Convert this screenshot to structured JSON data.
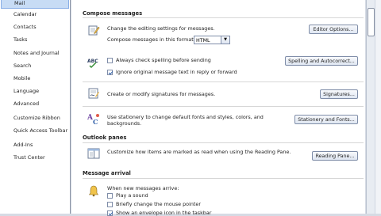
{
  "sidebar": {
    "items": [
      {
        "label": "Mail"
      },
      {
        "label": "Calendar"
      },
      {
        "label": "Contacts"
      },
      {
        "label": "Tasks"
      },
      {
        "label": "Notes and Journal"
      },
      {
        "label": "Search"
      },
      {
        "label": "Mobile"
      },
      {
        "label": "Language"
      },
      {
        "label": "Advanced"
      },
      {
        "label": "Customize Ribbon"
      },
      {
        "label": "Quick Access Toolbar"
      },
      {
        "label": "Add-Ins"
      },
      {
        "label": "Trust Center"
      }
    ]
  },
  "sections": {
    "compose": {
      "title": "Compose messages",
      "edit_settings": "Change the editing settings for messages.",
      "editor_options_button": "Editor Options...",
      "format_label": "Compose messages in this format:",
      "format_value": "HTML",
      "spell_check_label": "Always check spelling before sending",
      "spell_check_button": "Spelling and Autocorrect...",
      "ignore_original_label": "Ignore original message text in reply or forward",
      "signatures_label": "Create or modify signatures for messages.",
      "signatures_button": "Signatures...",
      "stationery_label_1": "Use stationery to change default fonts and styles, colors, and",
      "stationery_label_2": "backgrounds.",
      "stationery_button": "Stationery and Fonts..."
    },
    "outlook_panes": {
      "title": "Outlook panes",
      "reading_pane_label": "Customize how items are marked as read when using the Reading Pane.",
      "reading_pane_button": "Reading Pane..."
    },
    "message_arrival": {
      "title": "Message arrival",
      "when_new_label": "When new messages arrive:",
      "play_sound_label": "Play a sound",
      "change_pointer_label": "Briefly change the mouse pointer",
      "envelope_label": "Show an envelope icon in the taskbar"
    }
  },
  "checks": {
    "spell_check": false,
    "ignore_original": true,
    "play_sound": false,
    "change_pointer": false,
    "envelope": true
  }
}
